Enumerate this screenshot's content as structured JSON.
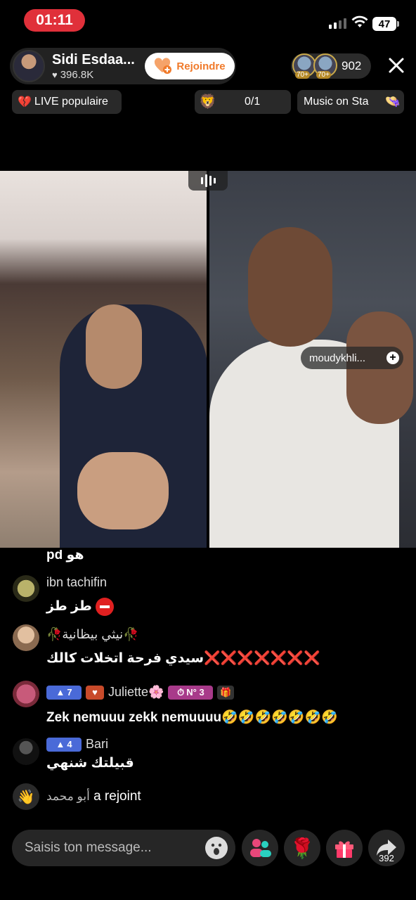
{
  "status_bar": {
    "time": "01:11",
    "battery": "47"
  },
  "host": {
    "name": "Sidi Esdaa...",
    "likes": "396.8K",
    "join_label": "Rejoindre"
  },
  "viewers": {
    "badge_1": "70+",
    "badge_2": "70+",
    "count": "902"
  },
  "chips": {
    "live_label": "LIVE populaire",
    "score": "0/1",
    "music_label": "Music on Sta"
  },
  "guest": {
    "name": "moudykhli..."
  },
  "chat": {
    "cut_text": "pd هو",
    "messages": [
      {
        "user": "ibn tachifin",
        "text": "طز طز"
      },
      {
        "user": "🥀نيثي بيظانية🥀",
        "text": "سيدي فرحة اتخلات كالك",
        "marks": "❌❌❌❌❌❌❌"
      },
      {
        "user": "Juliette🌸",
        "level": "7",
        "number_badge": "N° 3",
        "text": "Zek nemuuu zekk nemuuuu🤣🤣🤣🤣🤣🤣🤣"
      },
      {
        "user": "Bari",
        "level": "4",
        "text": "قبيلتك شنهي"
      }
    ],
    "join_user": "أبو محمد",
    "join_text": "a rejoint"
  },
  "bottom": {
    "input_placeholder": "Saisis ton message...",
    "share_count": "392"
  },
  "colors": {
    "accent_red": "#e0303a",
    "join_orange": "#f07a2a",
    "level_blue": "#4a6ad8"
  },
  "icons": [
    "heart-icon",
    "orange-heart-icon",
    "lion-icon",
    "hat-icon",
    "close-icon",
    "plus-icon",
    "stop-sign-icon",
    "wave-icon",
    "emoji-icon",
    "people-icon",
    "rose-icon",
    "gift-icon",
    "share-icon"
  ]
}
